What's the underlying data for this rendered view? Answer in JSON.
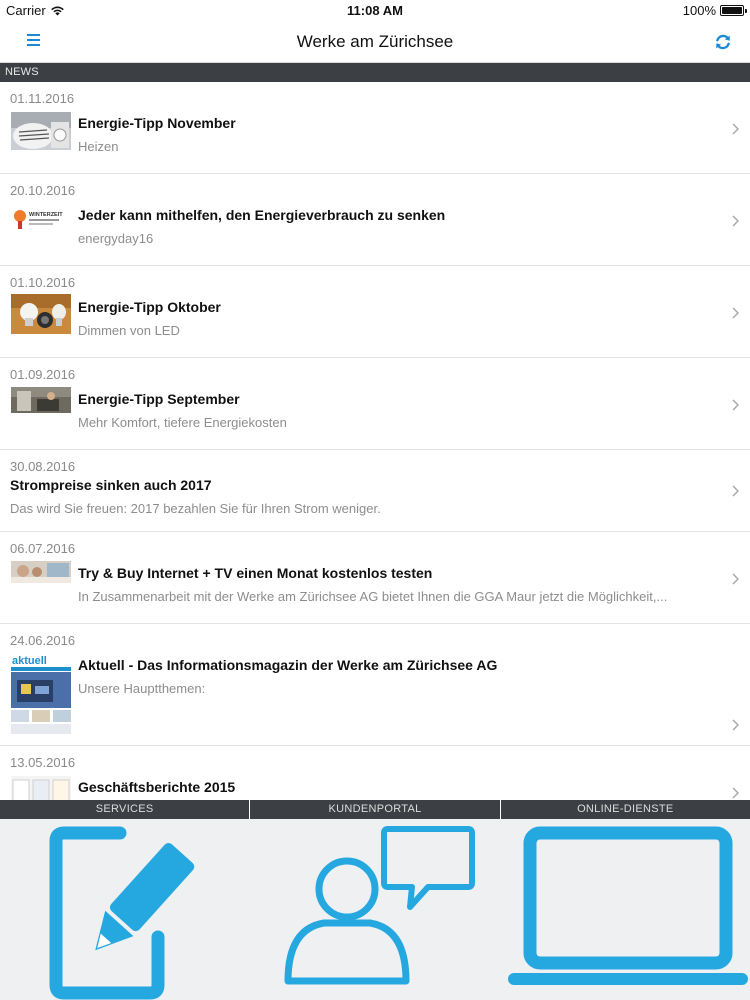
{
  "status_bar": {
    "carrier": "Carrier",
    "time": "11:08 AM",
    "battery": "100%"
  },
  "nav": {
    "title": "Werke am Zürichsee",
    "menu_icon": "hamburger-menu-icon",
    "refresh_icon": "refresh-icon"
  },
  "section": {
    "label": "NEWS"
  },
  "news": [
    {
      "date": "01.11.2016",
      "headline": "Energie-Tipp November",
      "sub": "Heizen"
    },
    {
      "date": "20.10.2016",
      "headline": "Jeder kann mithelfen, den Energieverbrauch zu senken",
      "sub": "energyday16"
    },
    {
      "date": "01.10.2016",
      "headline": "Energie-Tipp Oktober",
      "sub": "Dimmen von LED"
    },
    {
      "date": "01.09.2016",
      "headline": "Energie-Tipp September",
      "sub": "Mehr Komfort, tiefere Energiekosten"
    },
    {
      "date": "30.08.2016",
      "headline": "Strompreise sinken auch 2017",
      "sub": "Das wird Sie freuen: 2017 bezahlen Sie für Ihren Strom weniger."
    },
    {
      "date": "06.07.2016",
      "headline": "Try & Buy  Internet + TV einen Monat kostenlos testen",
      "sub": "In Zusammenarbeit mit der Werke am Zürichsee AG bietet Ihnen die GGA Maur jetzt die Möglichkeit,..."
    },
    {
      "date": "24.06.2016",
      "headline": "Aktuell - Das Informationsmagazin der Werke am Zürichsee AG",
      "sub": "Unsere Hauptthemen:",
      "thumb_text": "aktuell"
    },
    {
      "date": "13.05.2016",
      "headline": "Geschäftsberichte 2015",
      "sub": ""
    }
  ],
  "thumb_text_winterzeit": "WINTERZEIT",
  "tabs": [
    {
      "label": "SERVICES",
      "icon": "edit-form-icon"
    },
    {
      "label": "KUNDENPORTAL",
      "icon": "customer-chat-icon"
    },
    {
      "label": "ONLINE-DIENSTE",
      "icon": "laptop-icon"
    }
  ],
  "colors": {
    "accent": "#1a8ad4",
    "icon_blue": "#25a8e0",
    "dark_bar": "#3c3f44"
  }
}
